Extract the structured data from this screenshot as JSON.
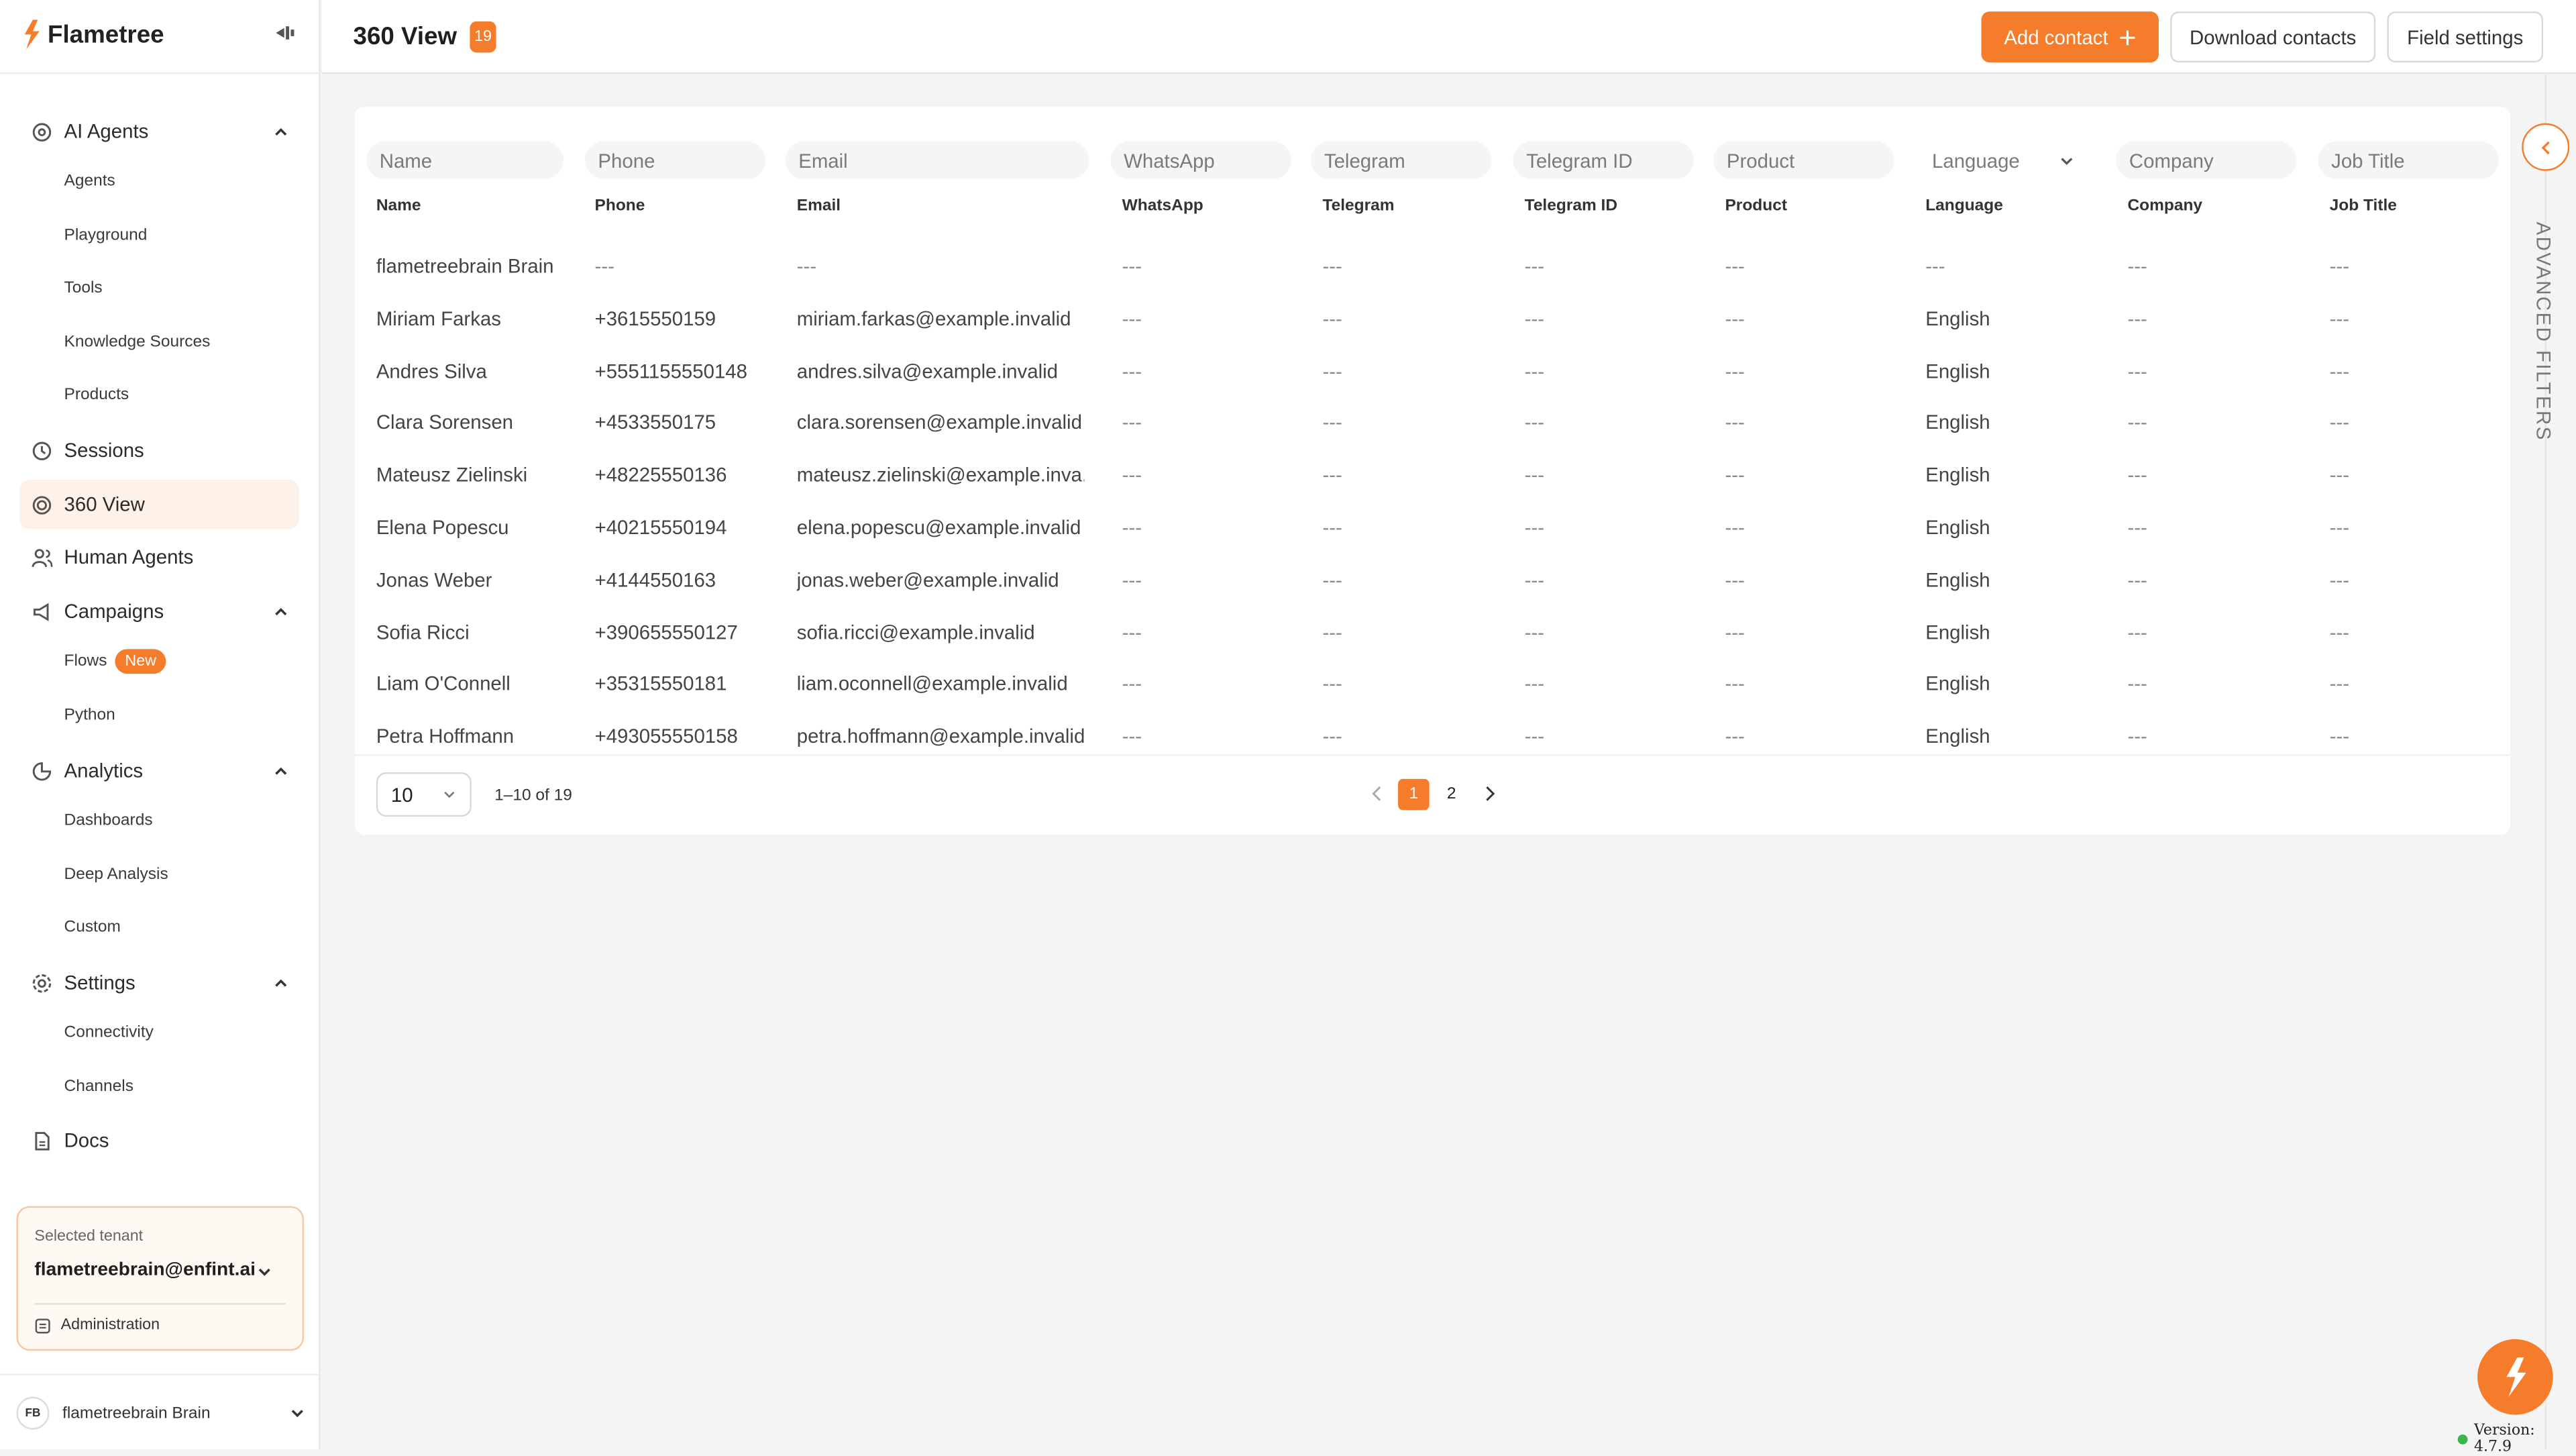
{
  "app": {
    "brand": "Flametree",
    "brand_color": "#f57c2b"
  },
  "sidebar": {
    "sections": [
      {
        "label": "AI Agents",
        "icon": "brain-icon",
        "expanded": true,
        "items": [
          "Agents",
          "Playground",
          "Tools",
          "Knowledge Sources",
          "Products"
        ]
      },
      {
        "label": "Sessions",
        "icon": "history-icon"
      },
      {
        "label": "360 View",
        "icon": "target-icon",
        "active": true
      },
      {
        "label": "Human Agents",
        "icon": "users-icon"
      },
      {
        "label": "Campaigns",
        "icon": "megaphone-icon",
        "expanded": true,
        "items": [
          "Flows",
          "Python"
        ],
        "new_badge": "New"
      },
      {
        "label": "Analytics",
        "icon": "chart-icon",
        "expanded": true,
        "items": [
          "Dashboards",
          "Deep Analysis",
          "Custom"
        ]
      },
      {
        "label": "Settings",
        "icon": "gear-icon",
        "expanded": true,
        "items": [
          "Connectivity",
          "Channels"
        ]
      },
      {
        "label": "Docs",
        "icon": "docs-icon"
      }
    ],
    "tenant": {
      "label": "Selected tenant",
      "value": "flametreebrain@enfint.ai",
      "admin": "Administration"
    },
    "user": {
      "initials": "FB",
      "name": "flametreebrain Brain"
    }
  },
  "header": {
    "title": "360 View",
    "count": "19",
    "add_contact": "Add contact",
    "download_contacts": "Download contacts",
    "field_settings": "Field settings"
  },
  "table": {
    "filters": [
      "Name",
      "Phone",
      "Email",
      "WhatsApp",
      "Telegram",
      "Telegram ID",
      "Product",
      "Language",
      "Company",
      "Job Title"
    ],
    "columns": [
      "Name",
      "Phone",
      "Email",
      "WhatsApp",
      "Telegram",
      "Telegram ID",
      "Product",
      "Language",
      "Company",
      "Job Title"
    ],
    "rows": [
      [
        "flametreebrain Brain",
        "---",
        "---",
        "---",
        "---",
        "---",
        "---",
        "---",
        "---",
        "---"
      ],
      [
        "Miriam Farkas",
        "+3615550159",
        "miriam.farkas@example.invalid",
        "---",
        "---",
        "---",
        "---",
        "English",
        "---",
        "---"
      ],
      [
        "Andres Silva",
        "+5551155550148",
        "andres.silva@example.invalid",
        "---",
        "---",
        "---",
        "---",
        "English",
        "---",
        "---"
      ],
      [
        "Clara Sorensen",
        "+4533550175",
        "clara.sorensen@example.invalid",
        "---",
        "---",
        "---",
        "---",
        "English",
        "---",
        "---"
      ],
      [
        "Mateusz Zielinski",
        "+48225550136",
        "mateusz.zielinski@example.inva...",
        "---",
        "---",
        "---",
        "---",
        "English",
        "---",
        "---"
      ],
      [
        "Elena Popescu",
        "+40215550194",
        "elena.popescu@example.invalid",
        "---",
        "---",
        "---",
        "---",
        "English",
        "---",
        "---"
      ],
      [
        "Jonas Weber",
        "+4144550163",
        "jonas.weber@example.invalid",
        "---",
        "---",
        "---",
        "---",
        "English",
        "---",
        "---"
      ],
      [
        "Sofia Ricci",
        "+390655550127",
        "sofia.ricci@example.invalid",
        "---",
        "---",
        "---",
        "---",
        "English",
        "---",
        "---"
      ],
      [
        "Liam O'Connell",
        "+35315550181",
        "liam.oconnell@example.invalid",
        "---",
        "---",
        "---",
        "---",
        "English",
        "---",
        "---"
      ],
      [
        "Petra Hoffmann",
        "+493055550158",
        "petra.hoffmann@example.invalid",
        "---",
        "---",
        "---",
        "---",
        "English",
        "---",
        "---"
      ]
    ]
  },
  "pagination": {
    "page_size": "10",
    "range": "1–10 of 19",
    "pages": [
      "1",
      "2"
    ],
    "current": "1"
  },
  "advanced_filters": "ADVANCED FILTERS",
  "version": "Version: 4.7.9"
}
